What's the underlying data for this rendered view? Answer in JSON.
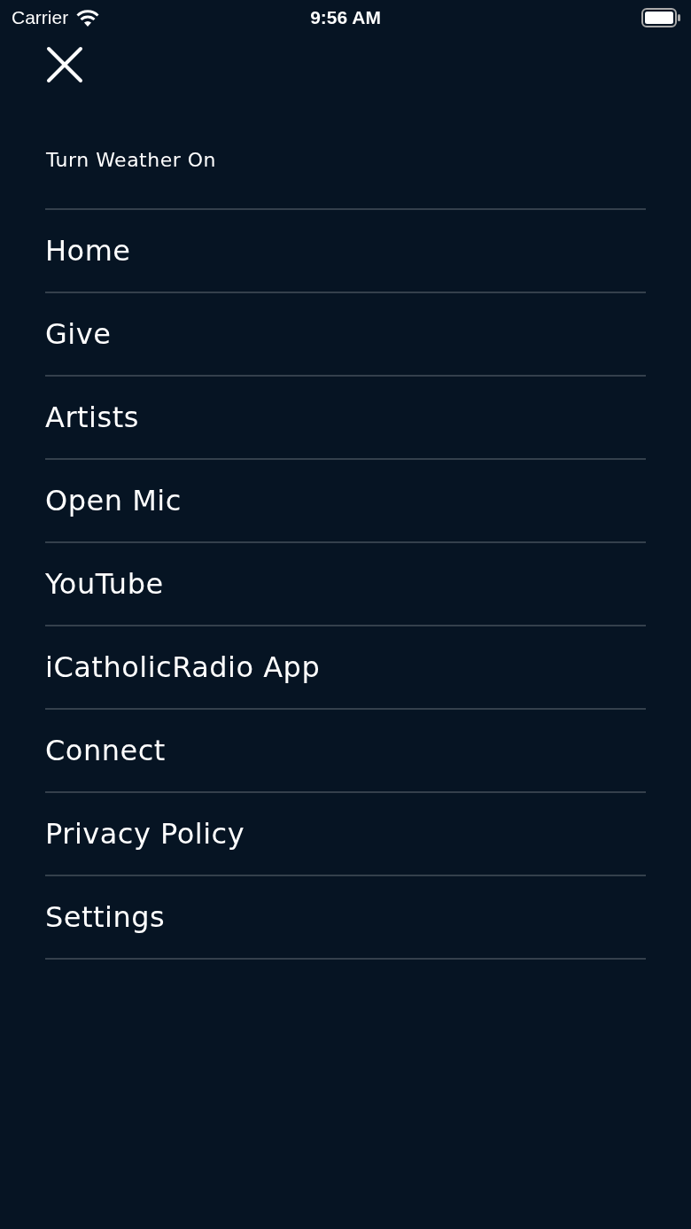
{
  "status_bar": {
    "carrier": "Carrier",
    "time": "9:56 AM"
  },
  "weather_toggle": {
    "label": "Turn Weather On"
  },
  "menu": [
    {
      "label": "Home"
    },
    {
      "label": "Give"
    },
    {
      "label": "Artists"
    },
    {
      "label": "Open Mic"
    },
    {
      "label": "YouTube"
    },
    {
      "label": "iCatholicRadio App"
    },
    {
      "label": "Connect"
    },
    {
      "label": "Privacy Policy"
    },
    {
      "label": "Settings"
    }
  ]
}
